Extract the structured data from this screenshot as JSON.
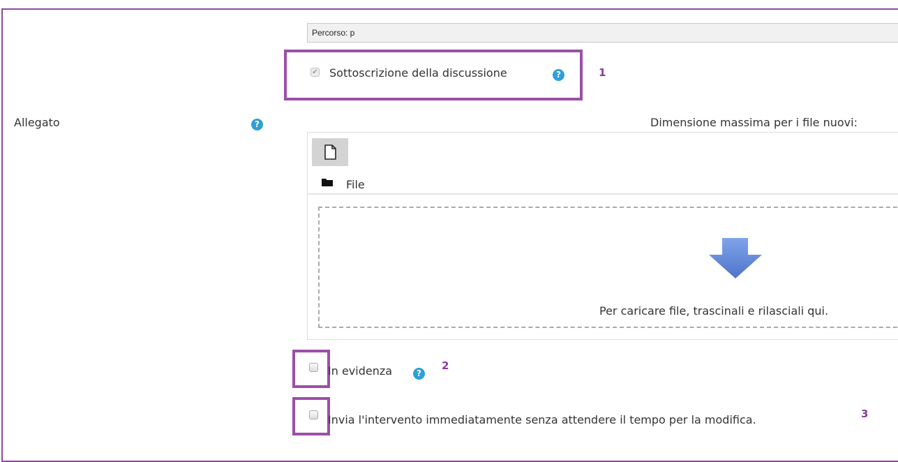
{
  "path_field": {
    "label": "Percorso: p"
  },
  "subscription": {
    "label": "Sottoscrizione della discussione",
    "checked": true,
    "disabled": true,
    "help_icon": "question-circle-icon",
    "annotation": "1"
  },
  "attachment": {
    "label": "Allegato",
    "help_icon": "question-circle-icon",
    "max_size_label": "Dimensione massima per i file nuovi:",
    "toolbar": {
      "add_file_icon": "file-icon"
    },
    "breadcrumb": {
      "folder_icon": "folder-icon",
      "label": "File"
    },
    "dropzone": {
      "arrow_icon": "down-arrow-icon",
      "text": "Per caricare file, trascinali e rilasciali qui."
    }
  },
  "pinned": {
    "label": "In evidenza",
    "checked": false,
    "help_icon": "question-circle-icon",
    "annotation": "2"
  },
  "post_now": {
    "label": "Invia l'intervento immediatamente senza attendere il tempo per la modifica.",
    "checked": false,
    "annotation": "3"
  },
  "colors": {
    "highlight": "#9c4fa8",
    "help_icon": "#2f9fd8",
    "arrow": "#5a7fd1"
  }
}
